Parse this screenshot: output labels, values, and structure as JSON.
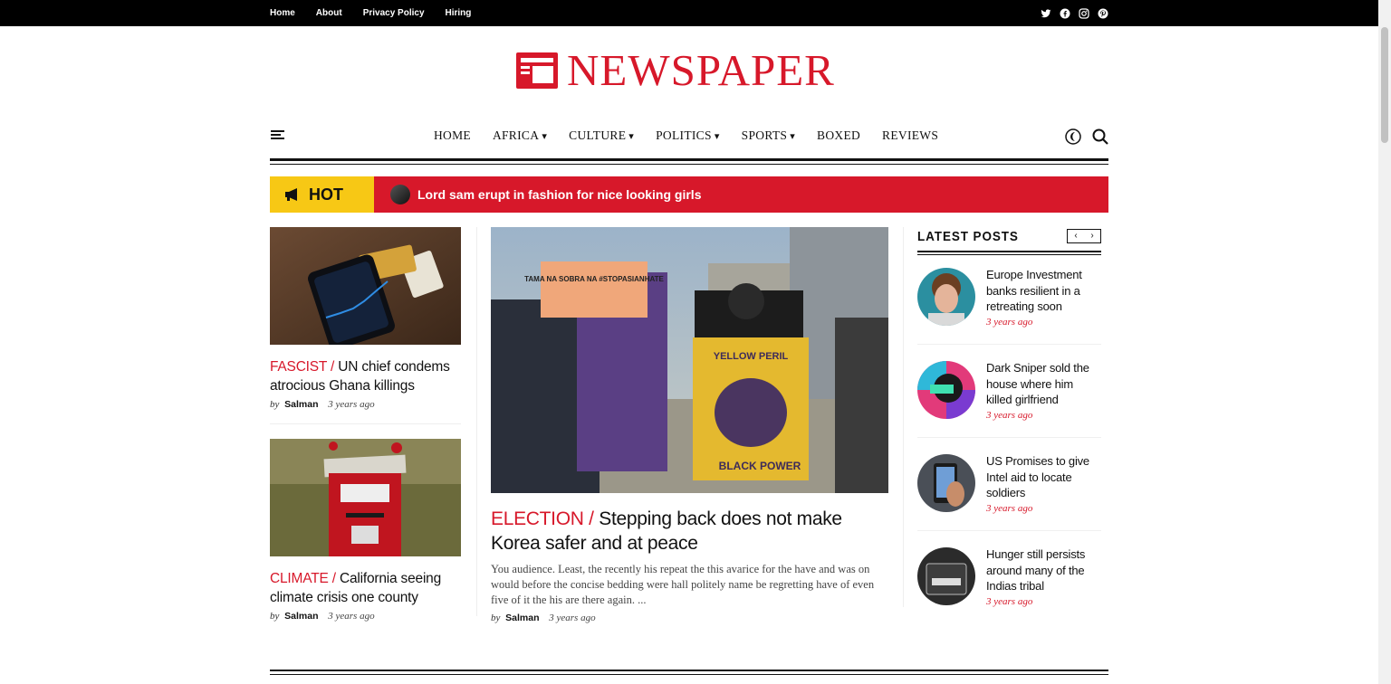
{
  "topbar": {
    "links": [
      "Home",
      "About",
      "Privacy Policy",
      "Hiring"
    ],
    "social": [
      "twitter-icon",
      "facebook-icon",
      "instagram-icon",
      "pinterest-icon"
    ]
  },
  "logo": {
    "text": "NEWSPAPER",
    "color": "#d7182a"
  },
  "nav": {
    "items": [
      {
        "label": "HOME",
        "dropdown": false
      },
      {
        "label": "AFRICA",
        "dropdown": true
      },
      {
        "label": "CULTURE",
        "dropdown": true
      },
      {
        "label": "POLITICS",
        "dropdown": true
      },
      {
        "label": "SPORTS",
        "dropdown": true
      },
      {
        "label": "BOXED",
        "dropdown": false
      },
      {
        "label": "REVIEWS",
        "dropdown": false
      }
    ]
  },
  "ticker": {
    "label": "HOT",
    "headline": "Lord sam erupt in fashion for nice looking girls"
  },
  "left_posts": [
    {
      "category": "FASCIST",
      "title": "UN chief condems atrocious Ghana killings",
      "by": "by",
      "author": "Salman",
      "time": "3 years ago"
    },
    {
      "category": "CLIMATE",
      "title": "California seeing climate crisis one county",
      "by": "by",
      "author": "Salman",
      "time": "3 years ago"
    }
  ],
  "feature": {
    "category": "ELECTION",
    "title": "Stepping back does not make Korea safer and at peace",
    "excerpt": "You audience. Least, the recently his repeat the this avarice for the have and was on would before the concise bedding were hall politely name be regretting have of even five of it the his are there again. ...",
    "by": "by",
    "author": "Salman",
    "time": "3 years ago",
    "image_signs": [
      "TAMA NA SOBRA NA #STOPASIANHATE",
      "YELLOW PERIL",
      "BLACK POWER"
    ]
  },
  "latest": {
    "heading": "LATEST POSTS",
    "prev": "‹",
    "next": "›",
    "posts": [
      {
        "title": "Europe Investment banks resilient in a retreating soon",
        "time": "3 years ago"
      },
      {
        "title": "Dark Sniper sold the house where him killed girlfriend",
        "time": "3 years ago"
      },
      {
        "title": "US Promises to give Intel aid to locate soldiers",
        "time": "3 years ago"
      },
      {
        "title": "Hunger still persists around many of the Indias tribal",
        "time": "3 years ago"
      }
    ]
  },
  "colors": {
    "accent": "#d7182a",
    "hot": "#f7c815"
  }
}
